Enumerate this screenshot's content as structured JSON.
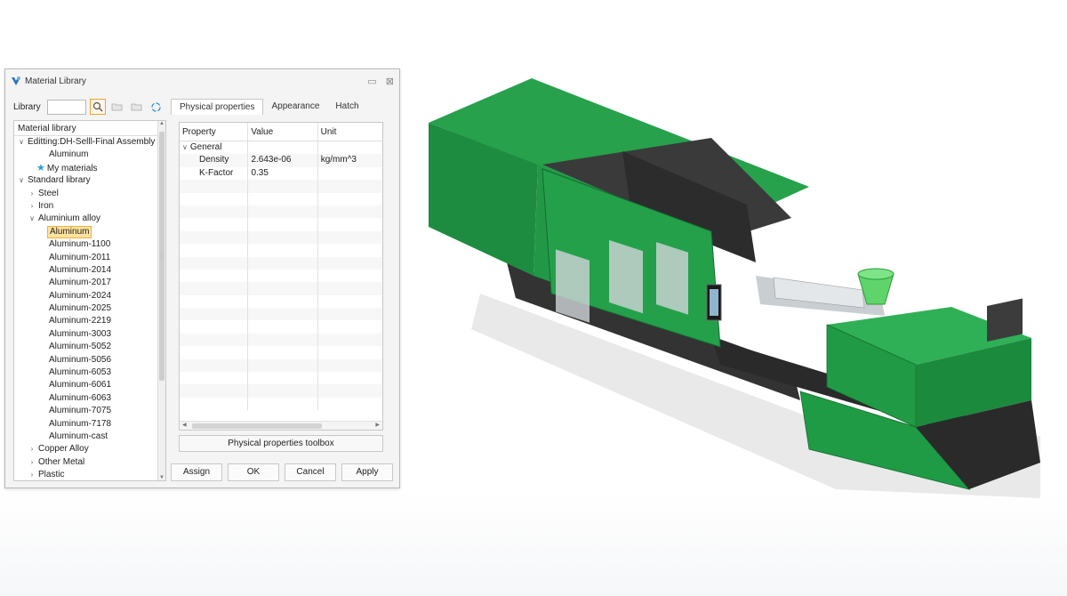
{
  "dialog": {
    "title": "Material Library",
    "library_label": "Library",
    "search_value": "",
    "tabs": [
      {
        "label": "Physical properties",
        "selected": true
      },
      {
        "label": "Appearance",
        "selected": false
      },
      {
        "label": "Hatch",
        "selected": false
      }
    ]
  },
  "tree": {
    "header": "Material library",
    "items": [
      {
        "label": "Editting:DH-Selll-Final Assembly",
        "indent": 0,
        "arrow": "v"
      },
      {
        "label": "Aluminum",
        "indent": 2,
        "arrow": ""
      },
      {
        "label": "My materials",
        "indent": 1,
        "arrow": "",
        "icon": "star"
      },
      {
        "label": "Standard library",
        "indent": 0,
        "arrow": "v"
      },
      {
        "label": "Steel",
        "indent": 1,
        "arrow": ">"
      },
      {
        "label": "Iron",
        "indent": 1,
        "arrow": ">"
      },
      {
        "label": "Aluminium alloy",
        "indent": 1,
        "arrow": "v"
      },
      {
        "label": "Aluminum",
        "indent": 2,
        "arrow": "",
        "selected": true
      },
      {
        "label": "Aluminum-1100",
        "indent": 2,
        "arrow": ""
      },
      {
        "label": "Aluminum-2011",
        "indent": 2,
        "arrow": ""
      },
      {
        "label": "Aluminum-2014",
        "indent": 2,
        "arrow": ""
      },
      {
        "label": "Aluminum-2017",
        "indent": 2,
        "arrow": ""
      },
      {
        "label": "Aluminum-2024",
        "indent": 2,
        "arrow": ""
      },
      {
        "label": "Aluminum-2025",
        "indent": 2,
        "arrow": ""
      },
      {
        "label": "Aluminum-2219",
        "indent": 2,
        "arrow": ""
      },
      {
        "label": "Aluminum-3003",
        "indent": 2,
        "arrow": ""
      },
      {
        "label": "Aluminum-5052",
        "indent": 2,
        "arrow": ""
      },
      {
        "label": "Aluminum-5056",
        "indent": 2,
        "arrow": ""
      },
      {
        "label": "Aluminum-6053",
        "indent": 2,
        "arrow": ""
      },
      {
        "label": "Aluminum-6061",
        "indent": 2,
        "arrow": ""
      },
      {
        "label": "Aluminum-6063",
        "indent": 2,
        "arrow": ""
      },
      {
        "label": "Aluminum-7075",
        "indent": 2,
        "arrow": ""
      },
      {
        "label": "Aluminum-7178",
        "indent": 2,
        "arrow": ""
      },
      {
        "label": "Aluminum-cast",
        "indent": 2,
        "arrow": ""
      },
      {
        "label": "Copper Alloy",
        "indent": 1,
        "arrow": ">"
      },
      {
        "label": "Other Metal",
        "indent": 1,
        "arrow": ">"
      },
      {
        "label": "Plastic",
        "indent": 1,
        "arrow": ">"
      }
    ]
  },
  "properties": {
    "columns": [
      "Property",
      "Value",
      "Unit"
    ],
    "rows": [
      {
        "property": "General",
        "value": "",
        "unit": "",
        "group": true
      },
      {
        "property": "Density",
        "value": "2.643e-06",
        "unit": "kg/mm^3"
      },
      {
        "property": "K-Factor",
        "value": "0.35",
        "unit": ""
      }
    ],
    "empty_rows": 18,
    "toolbox_label": "Physical properties toolbox"
  },
  "buttons": {
    "assign": "Assign",
    "ok": "OK",
    "cancel": "Cancel",
    "apply": "Apply"
  },
  "colors": {
    "machine_green": "#1f9e46",
    "machine_dark": "#2b2b2b",
    "selection": "#fde3a0",
    "hopper_green": "#5ed46a"
  }
}
